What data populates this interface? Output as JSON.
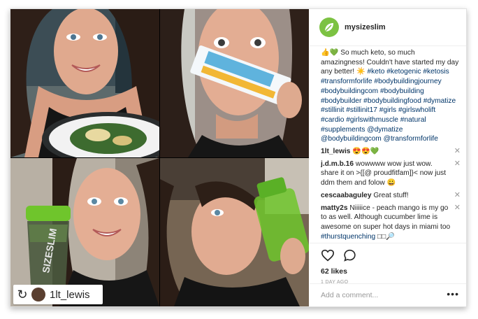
{
  "post": {
    "username": "mysizeslim",
    "tagged_user": "1lt_lewis",
    "caption_prefix": "👍💚 So much keto, so much amazingness! Couldn't have started my day any better! ☀️",
    "caption_tags": "#keto #ketogenic #ketosis #transformforlife #bodybuildingjourney #bodybuildingcom #bodybuilding #bodybuilder #bodybuildingfood #dymatize #stillinit #stillinit17 #girls #girlswholift #cardio #girlswithmuscle #natural #supplements @dymatize @bodybuildingcom @transformforlife",
    "likes": "62 likes",
    "time_ago": "1 DAY AGO",
    "comment_placeholder": "Add a comment...",
    "more_label": "•••"
  },
  "comments": [
    {
      "user": "1lt_lewis",
      "text": "😍😍💚"
    },
    {
      "user": "j.d.m.b.16",
      "text": "wowwww wow just wow. share it on >{[@ proudfitfam]}< now just ddm them and folow 😀"
    },
    {
      "user": "cescaabaguley",
      "text": "Great stuff!"
    },
    {
      "user": "matty2s",
      "text": "Niiiiice - peach mango is my go to as well. Although cucumber lime is awesome on super hot days in miami too",
      "tag": "#thurstquenching",
      "tail": "□□🔎"
    }
  ],
  "colors": {
    "brand": "#7cc242",
    "link": "#003569",
    "shaker": "#6fc52c"
  },
  "icons": [
    "heart-icon",
    "comment-icon",
    "repost-icon",
    "close-icon",
    "more-icon"
  ]
}
